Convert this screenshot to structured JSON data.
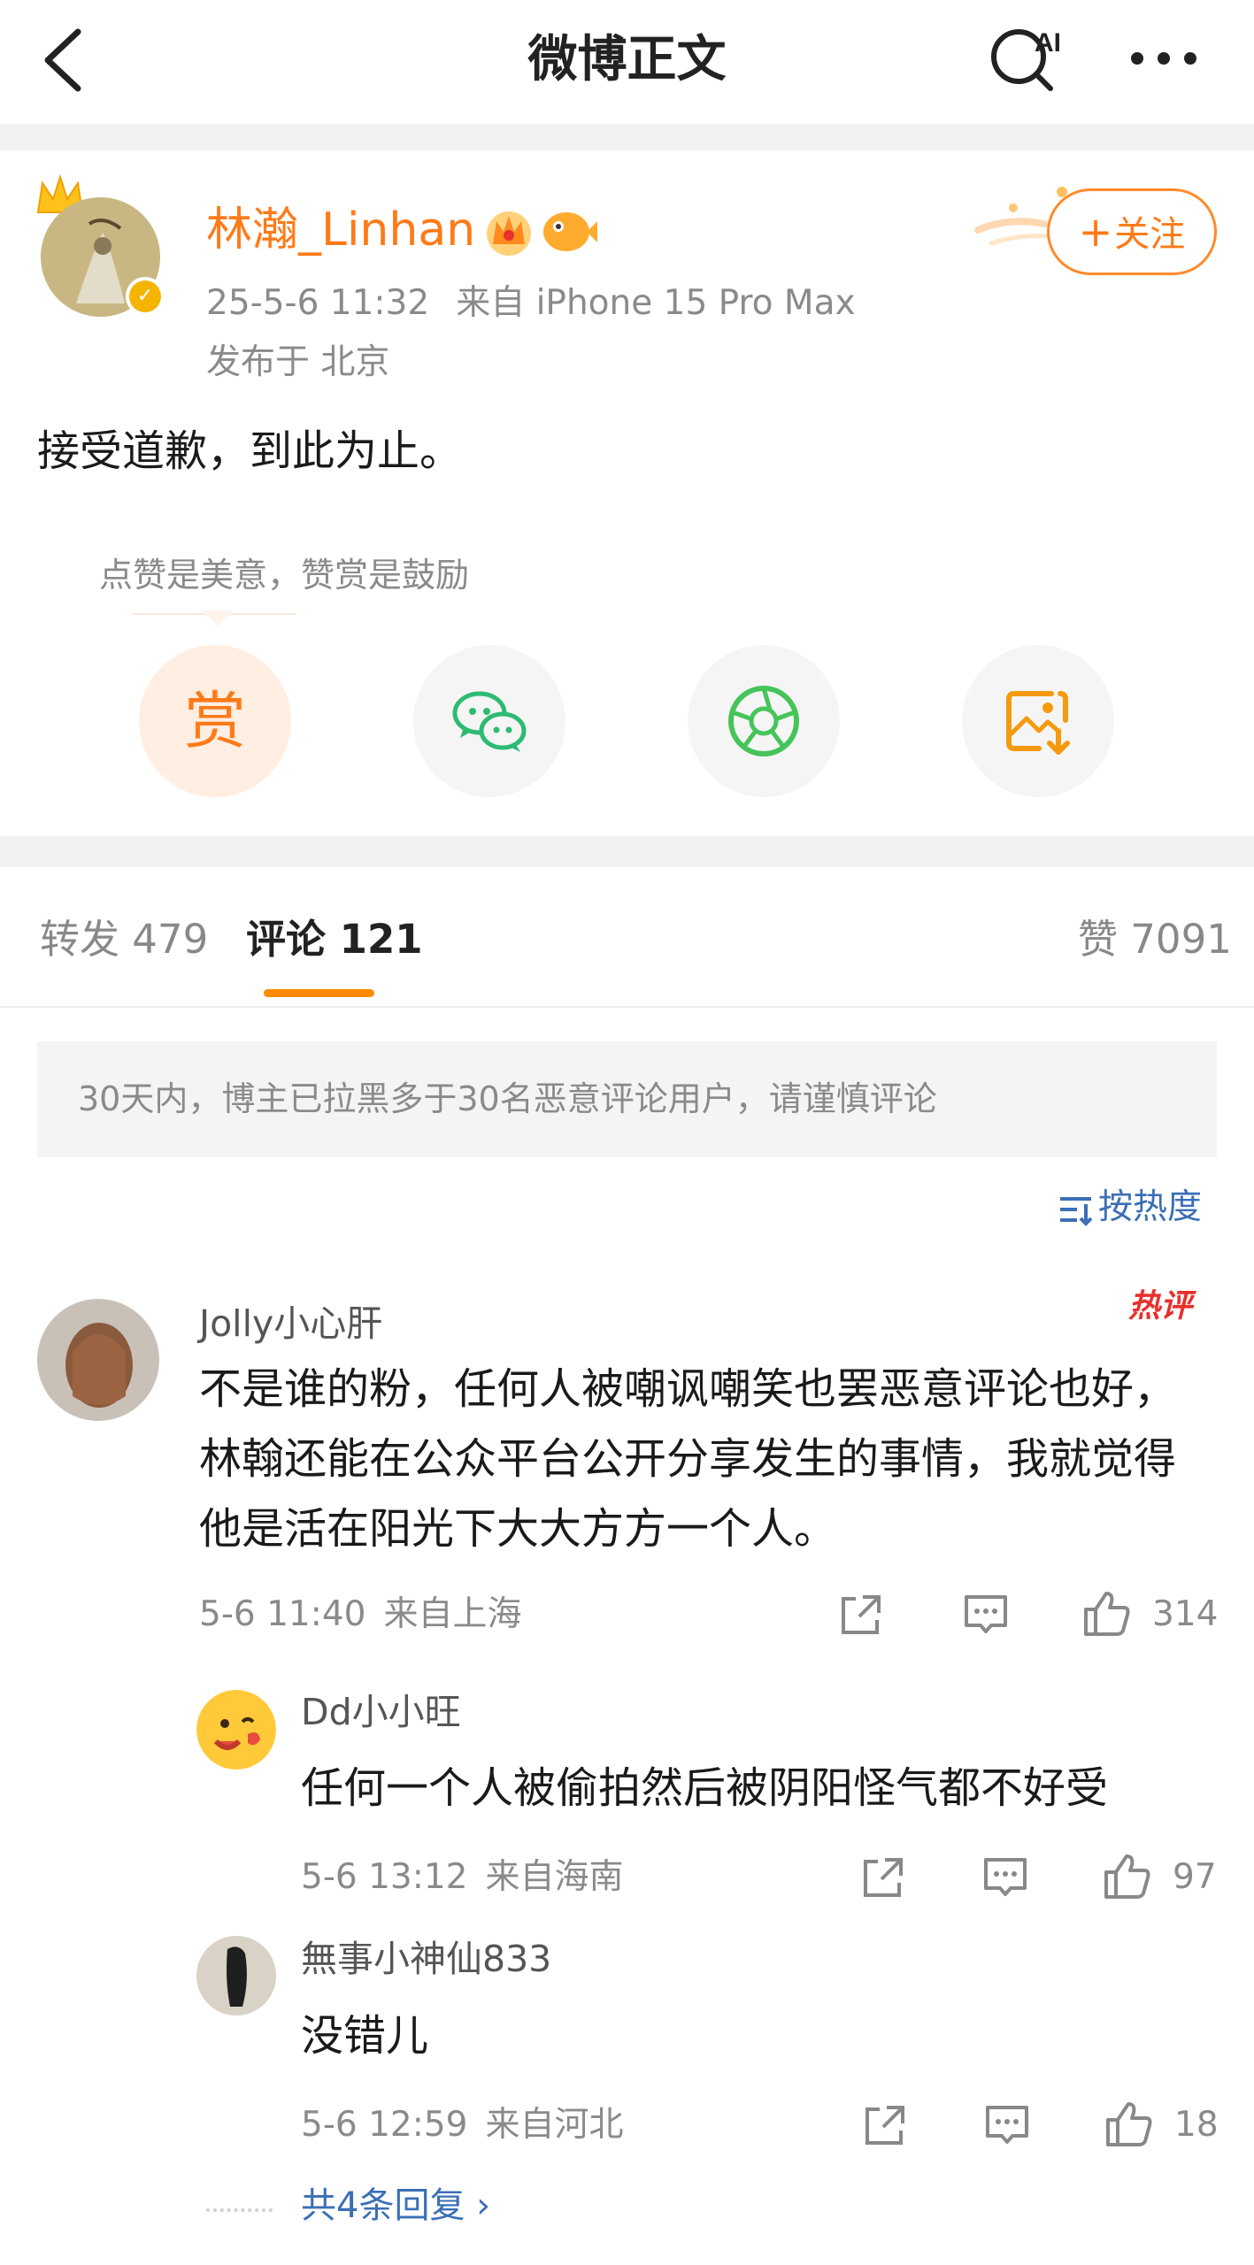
{
  "header": {
    "title": "微博正文",
    "back_icon": "chevron-left-icon",
    "ai_search_label": "AI",
    "more_icon": "more-horizontal-icon"
  },
  "post": {
    "author": "林瀚_Linhan",
    "time": "25-5-6 11:32",
    "source": "来自 iPhone 15 Pro Max",
    "location": "发布于 北京",
    "follow_label": "关注",
    "follow_plus": "+",
    "content": "接受道歉，到此为止。",
    "accent_color": "#ff7a18"
  },
  "reward": {
    "hint": "点赞是美意，赞赏是鼓励",
    "reward_label": "赏",
    "share_icons": [
      "wechat-icon",
      "moments-icon",
      "save-image-icon"
    ]
  },
  "tabs": {
    "repost": "转发 479",
    "comments": "评论 121",
    "likes": "赞 7091"
  },
  "notice": "30天内，博主已拉黑多于30名恶意评论用户，请谨慎评论",
  "sort_label": "按热度",
  "comments": [
    {
      "user": "Jolly小心肝",
      "hot_tag": "热评",
      "text": "不是谁的粉，任何人被嘲讽嘲笑也罢恶意评论也好，林翰还能在公众平台公开分享发生的事情，我就觉得他是活在阳光下大大方方一个人。",
      "time": "5-6 11:40",
      "location": "来自上海",
      "likes": "314"
    }
  ],
  "replies": [
    {
      "user": "Dd小小旺",
      "text": "任何一个人被偷拍然后被阴阳怪气都不好受",
      "time": "5-6 13:12",
      "location": "来自海南",
      "likes": "97"
    },
    {
      "user": "無事小神仙833",
      "text": "没错儿",
      "time": "5-6 12:59",
      "location": "来自河北",
      "likes": "18"
    }
  ],
  "more_replies_label": "共4条回复 ›"
}
